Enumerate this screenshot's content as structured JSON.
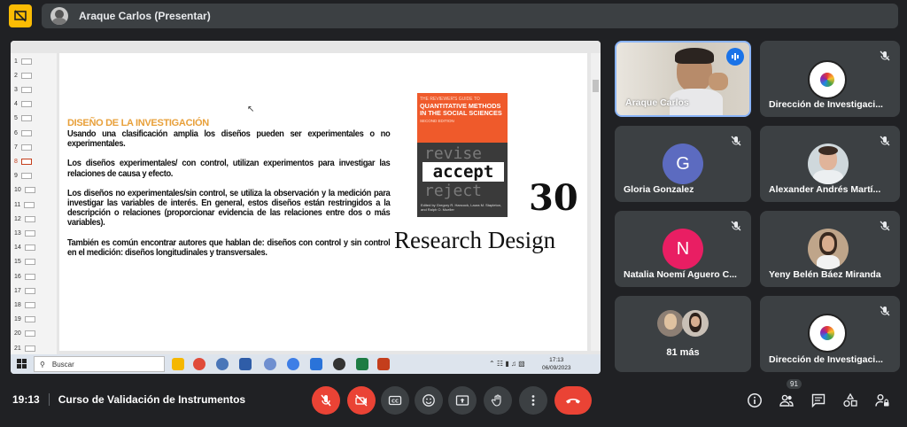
{
  "top": {
    "presenter_label": "Araque Carlos (Presentar)"
  },
  "slide": {
    "thumb_numbers": [
      "1",
      "2",
      "3",
      "4",
      "5",
      "6",
      "7",
      "8",
      "9",
      "10",
      "11",
      "12",
      "13",
      "14",
      "15",
      "16",
      "17",
      "18",
      "19",
      "20",
      "21"
    ],
    "active_thumb": "8",
    "title": "DISEÑO DE LA INVESTIGACIÓN",
    "paragraphs": [
      "Usando una clasificación amplia los diseños pueden ser experimentales o no experimentales.",
      "Los diseños experimentales/ con control, utilizan experimentos para investigar las relaciones de causa y efecto.",
      "Los diseños no experimentales/sin control, se utiliza la observación y la medición para investigar las variables de interés. En general, estos diseños están restringidos a la descripción o relaciones (proporcionar evidencia de las relaciones entre dos o más variables).",
      "También es común encontrar autores que hablan de: diseños con control y sin control en el medición: diseños longitudinales y transversales."
    ],
    "book": {
      "series": "THE REVIEWER'S GUIDE TO",
      "title": "QUANTITATIVE METHODS IN THE SOCIAL SCIENCES",
      "edition": "SECOND EDITION",
      "word1": "revise",
      "word2": "accept",
      "word3": "reject",
      "authors": "Edited by Gregory R. Hancock, Laura M. Stapleton, and Ralph O. Mueller"
    },
    "chapter_number": "30",
    "chapter_title": "Research Design"
  },
  "taskbar": {
    "search_label": "Buscar",
    "clock_time": "17:13",
    "clock_date": "06/09/2023"
  },
  "participants": [
    {
      "name": "Araque Carlos",
      "type": "video",
      "speaking": true
    },
    {
      "name": "Dirección de Investigaci...",
      "type": "logo",
      "muted": true
    },
    {
      "name": "Gloria Gonzalez",
      "type": "initial",
      "initial": "G",
      "color": "#5c6bc0",
      "muted": true
    },
    {
      "name": "Alexander Andrés Martí...",
      "type": "photo",
      "muted": true
    },
    {
      "name": "Natalia Noemí Aguero C...",
      "type": "initial",
      "initial": "N",
      "color": "#e91e63",
      "muted": true
    },
    {
      "name": "Yeny Belén Báez Miranda",
      "type": "photo",
      "muted": true
    },
    {
      "name": "81 más",
      "type": "group"
    },
    {
      "name": "Dirección de Investigaci...",
      "type": "logo",
      "muted": true
    }
  ],
  "bottom": {
    "time": "19:13",
    "meeting_title": "Curso de Validación de Instrumentos",
    "participant_count": "91"
  },
  "colors": {
    "danger": "#ea4335",
    "control_bg": "#3c4043",
    "accent_speaking": "#8ab4f8"
  }
}
